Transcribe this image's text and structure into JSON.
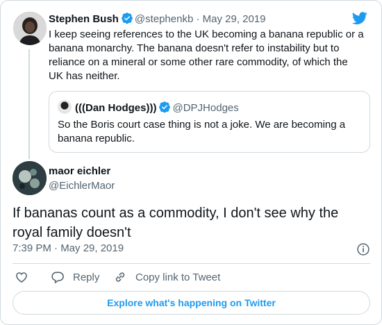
{
  "parent_tweet": {
    "name": "Stephen Bush",
    "handle": "@stephenkb",
    "date": "· May 29, 2019",
    "text": "I keep seeing references to the UK becoming a banana republic or a banana monarchy. The banana doesn't refer to instability but to reliance on a mineral or some other rare commodity, of which the UK has neither."
  },
  "quoted_tweet": {
    "name": "(((Dan Hodges)))",
    "handle": "@DPJHodges",
    "text": "So the Boris court case thing is not a joke. We are becoming a banana republic."
  },
  "main_tweet": {
    "name": "maor eichler",
    "handle": "@EichlerMaor",
    "text": "If bananas count as a commodity, I don't see why the royal family doesn't",
    "timestamp": "7:39 PM · May 29, 2019"
  },
  "actions": {
    "reply_label": "Reply",
    "copy_link_label": "Copy link to Tweet"
  },
  "explore_label": "Explore what's happening on Twitter",
  "colors": {
    "twitter_blue": "#1d9bf0",
    "text_primary": "#0f1419",
    "text_secondary": "#536471",
    "border": "#cfd9de"
  }
}
